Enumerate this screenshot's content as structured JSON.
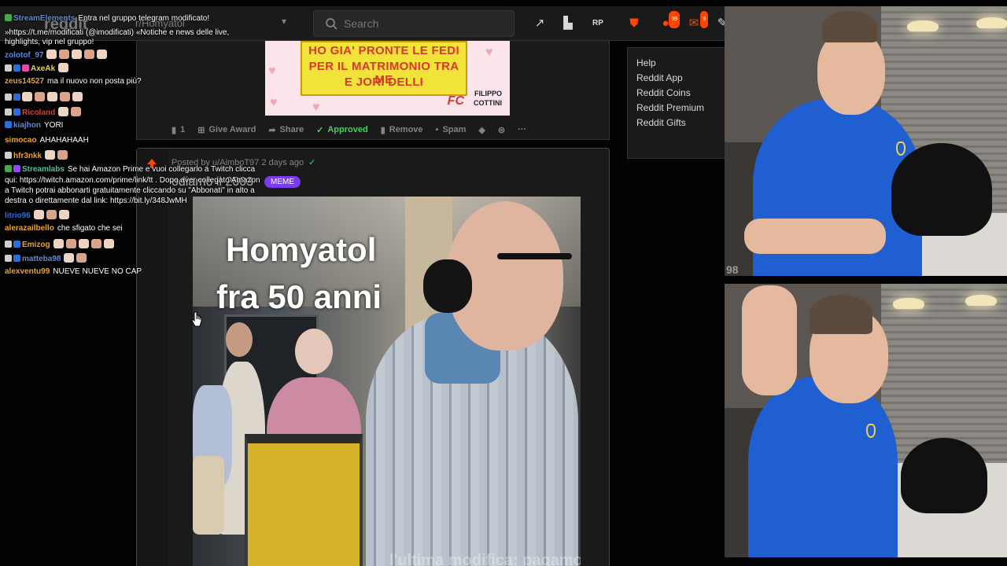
{
  "reddit": {
    "logo_text": "reddit",
    "community": "r/Homyatol",
    "search_placeholder": "Search",
    "notif_badge": "99",
    "mail_badge": "9",
    "post1": {
      "banner_lines": [
        "HO GIA' PRONTE LE FEDI",
        "PER IL MATRIMONIO TRA ME",
        "E JORI DELLI"
      ],
      "banner_brand": [
        "FILIPPO",
        "COTTINI"
      ],
      "banner_logo": "FC",
      "comments": "1",
      "give_award": "Give Award",
      "share": "Share",
      "approved": "Approved",
      "remove": "Remove",
      "spam": "Spam"
    },
    "post2": {
      "meta": "Posted by u/AimboT97 2 days ago",
      "title": "odiamo il 2003",
      "flair": "MEME",
      "meme_line1": "Homyatol",
      "meme_line2": "fra 50 anni",
      "caption": "l'ultima modifica: pagamosc"
    },
    "sidebar_links": [
      "Help",
      "Reddit App",
      "Reddit Coins",
      "Reddit Premium",
      "Reddit Gifts"
    ]
  },
  "chat": {
    "messages": [
      {
        "user": "StreamElements",
        "color": "#5e8ad6",
        "text": "Entra nel gruppo telegram modificato!",
        "badges": [
          "#46a94a"
        ]
      },
      {
        "user": "",
        "color": "#ffffff",
        "text": "»https://t.me/modificati (@imodificati) «Notiche e news delle live,",
        "badges": []
      },
      {
        "user": "",
        "color": "#ffffff",
        "text": "highlights, vip nel gruppo!",
        "badges": []
      },
      {
        "user": "zolotof_97",
        "color": "#5e8ad6",
        "text": "",
        "emotes": 5,
        "badges": []
      },
      {
        "user": "AxeAk",
        "color": "#e9d44a",
        "text": "",
        "emotes": 1,
        "badges": [
          "#cfcfcf",
          "#2b6fd6",
          "#e34ba9"
        ]
      },
      {
        "user": "zeus14527",
        "color": "#e9a32a",
        "text": "ma il nuovo non posta più?",
        "badges": []
      },
      {
        "user": "",
        "color": "#ffffff",
        "text": "",
        "emotes": 5,
        "badges": [
          "#cfcfcf",
          "#2b6fd6"
        ]
      },
      {
        "user": "Ricoland",
        "color": "#e33b2c",
        "text": "",
        "emotes": 2,
        "badges": [
          "#cfcfcf",
          "#2b6fd6"
        ]
      },
      {
        "user": "kiajhon",
        "color": "#5e8ad6",
        "text": "YORI",
        "badges": [
          "#2b6fd6"
        ]
      },
      {
        "user": "simocao",
        "color": "#e9a32a",
        "text": "AHAHAHAAH",
        "badges": []
      },
      {
        "user": "hfr3nkk",
        "color": "#e9a32a",
        "text": "",
        "emotes": 2,
        "badges": [
          "#cfcfcf"
        ]
      },
      {
        "user": "Streamlabs",
        "color": "#46c6a4",
        "text": "Se hai Amazon Prime e vuoi collegarlo a Twitch clicca",
        "badges": [
          "#46a94a",
          "#9147ff"
        ]
      },
      {
        "user": "",
        "color": "#ffffff",
        "text": "qui: https://twitch.amazon.com/prime/link/tt . Dopo aver collegato Amazon",
        "badges": []
      },
      {
        "user": "",
        "color": "#ffffff",
        "text": "a Twitch potrai abbonarti gratuitamente cliccando su \"Abbonati\" in alto a",
        "badges": []
      },
      {
        "user": "",
        "color": "#ffffff",
        "text": "destra o direttamente dal link: https://bit.ly/348JwMH",
        "badges": []
      },
      {
        "user": "litrio96",
        "color": "#2b6fd6",
        "text": "",
        "emotes": 3,
        "badges": []
      },
      {
        "user": "alerazailbello",
        "color": "#e9a32a",
        "text": "che sfigato che sei",
        "badges": []
      },
      {
        "user": "Emizog",
        "color": "#e9a32a",
        "text": "",
        "emotes": 5,
        "badges": [
          "#cfcfcf",
          "#2b6fd6"
        ]
      },
      {
        "user": "matteba98",
        "color": "#5e8ad6",
        "text": "",
        "emotes": 2,
        "badges": [
          "#cfcfcf",
          "#2b6fd6"
        ]
      },
      {
        "user": "alexventu99",
        "color": "#e9a32a",
        "text": "NUEVE NUEVE NO CAP",
        "badges": []
      }
    ]
  },
  "cams": {
    "top_overlay": "98"
  }
}
